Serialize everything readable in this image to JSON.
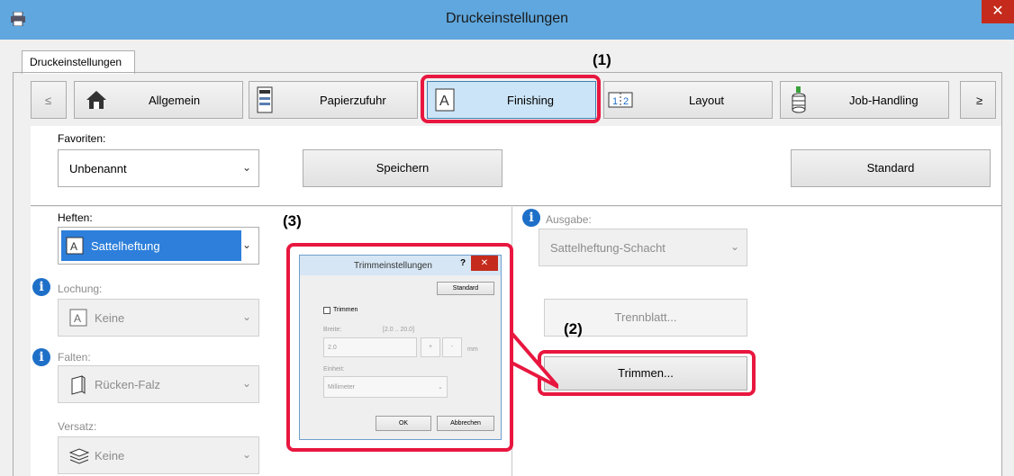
{
  "window": {
    "title": "Druckeinstellungen",
    "close_glyph": "✕"
  },
  "tab": {
    "label": "Druckeinstellungen"
  },
  "nav": {
    "prev": "≤",
    "next": "≥",
    "items": [
      {
        "label": "Allgemein",
        "icon": "home-icon"
      },
      {
        "label": "Papierzufuhr",
        "icon": "paper-tray-icon"
      },
      {
        "label": "Finishing",
        "icon": "finishing-icon"
      },
      {
        "label": "Layout",
        "icon": "layout-icon"
      },
      {
        "label": "Job-Handling",
        "icon": "job-handling-icon"
      }
    ],
    "selected": "Finishing"
  },
  "favorites": {
    "label": "Favoriten:",
    "value": "Unbenannt",
    "save_label": "Speichern",
    "default_label": "Standard"
  },
  "finishing": {
    "stapling_label": "Heften:",
    "stapling_value": "Sattelheftung",
    "punch_label": "Lochung:",
    "punch_value": "Keine",
    "fold_label": "Falten:",
    "fold_value": "Rücken-Falz",
    "offset_label": "Versatz:",
    "offset_value": "Keine",
    "output_label": "Ausgabe:",
    "output_value": "Sattelheftung-Schacht",
    "separator_label": "Trennblatt...",
    "trim_label": "Trimmen..."
  },
  "annotations": {
    "a1": "(1)",
    "a2": "(2)",
    "a3": "(3)"
  },
  "dialog": {
    "title": "Trimmeinstellungen",
    "help": "?",
    "close": "✕",
    "default_label": "Standard",
    "trim_checkbox": "Trimmen",
    "width_label": "Breite:",
    "range": "[2.0 .. 20.0]",
    "width_value": "2.0",
    "plus": "+",
    "minus": "-",
    "unit_short": "mm",
    "unit_label": "Einheit:",
    "unit_value": "Millimeter",
    "ok": "OK",
    "cancel": "Abbrechen"
  },
  "colors": {
    "accent": "#5fa7de",
    "highlight": "#e8173f",
    "selected": "#cce4f7"
  }
}
